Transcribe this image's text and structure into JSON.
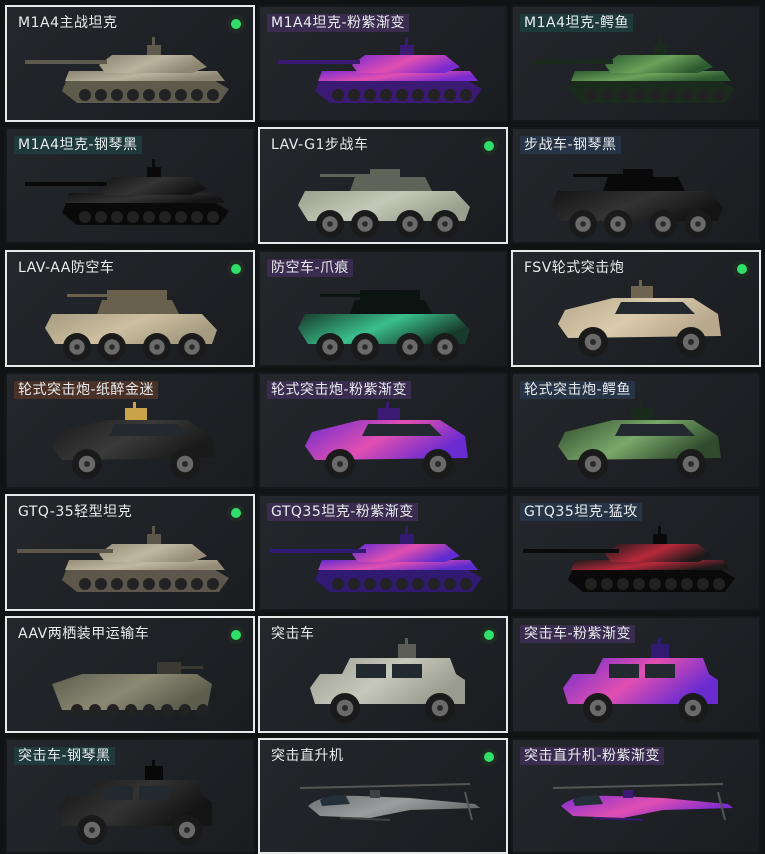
{
  "vehicles": [
    {
      "name": "M1A4主战坦克",
      "selected": true,
      "owned": true,
      "tag": "none",
      "kind": "tank",
      "palette": [
        "#8a8470",
        "#b9b49e",
        "#5f5b4c"
      ]
    },
    {
      "name": "M1A4坦克-粉紫渐变",
      "selected": false,
      "owned": false,
      "tag": "purple",
      "kind": "tank",
      "palette": [
        "#7a2bd0",
        "#e14fb1",
        "#3a1a72"
      ]
    },
    {
      "name": "M1A4坦克-鳄鱼",
      "selected": false,
      "owned": false,
      "tag": "teal",
      "kind": "tank",
      "palette": [
        "#2c5a30",
        "#6aa25a",
        "#1a2a1c"
      ]
    },
    {
      "name": "M1A4坦克-钢琴黑",
      "selected": false,
      "owned": false,
      "tag": "teal",
      "kind": "tank",
      "palette": [
        "#141414",
        "#343434",
        "#0a0a0a"
      ]
    },
    {
      "name": "LAV-G1步战车",
      "selected": true,
      "owned": true,
      "tag": "none",
      "kind": "apc",
      "palette": [
        "#9aa08d",
        "#c4c8b8",
        "#5e6458"
      ]
    },
    {
      "name": "步战车-钢琴黑",
      "selected": false,
      "owned": false,
      "tag": "slate",
      "kind": "apc",
      "palette": [
        "#141414",
        "#333333",
        "#090909"
      ]
    },
    {
      "name": "LAV-AA防空车",
      "selected": true,
      "owned": true,
      "tag": "none",
      "kind": "aa",
      "palette": [
        "#a59a80",
        "#cdbfa0",
        "#6a604e"
      ]
    },
    {
      "name": "防空车-爪痕",
      "selected": false,
      "owned": false,
      "tag": "purple",
      "kind": "aa",
      "palette": [
        "#183a2c",
        "#3ac08c",
        "#0b1410"
      ]
    },
    {
      "name": "FSV轮式突击炮",
      "selected": true,
      "owned": true,
      "tag": "none",
      "kind": "suv",
      "palette": [
        "#b8a88c",
        "#dacbad",
        "#6f6450"
      ]
    },
    {
      "name": "轮式突击炮-纸醉金迷",
      "selected": false,
      "owned": false,
      "tag": "brown",
      "kind": "suv",
      "palette": [
        "#1a1a1a",
        "#3a3a3a",
        "#c9a24a"
      ]
    },
    {
      "name": "轮式突击炮-粉紫渐变",
      "selected": false,
      "owned": false,
      "tag": "purple",
      "kind": "suv",
      "palette": [
        "#6a2bd0",
        "#e14fb1",
        "#3a1a72"
      ]
    },
    {
      "name": "轮式突击炮-鳄鱼",
      "selected": false,
      "owned": false,
      "tag": "slate",
      "kind": "suv",
      "palette": [
        "#2f4a2c",
        "#7aa86a",
        "#1a2a1c"
      ]
    },
    {
      "name": "GTQ-35轻型坦克",
      "selected": true,
      "owned": true,
      "tag": "none",
      "kind": "light",
      "palette": [
        "#958c78",
        "#c0b89f",
        "#5c574a"
      ]
    },
    {
      "name": "GTQ35坦克-粉紫渐变",
      "selected": false,
      "owned": false,
      "tag": "purple",
      "kind": "light",
      "palette": [
        "#5d2bd0",
        "#e14fb1",
        "#301a72"
      ]
    },
    {
      "name": "GTQ35坦克-猛攻",
      "selected": false,
      "owned": false,
      "tag": "slate",
      "kind": "light",
      "palette": [
        "#1a1a1a",
        "#b8293a",
        "#0a0a0a"
      ]
    },
    {
      "name": "AAV两栖装甲运输车",
      "selected": true,
      "owned": true,
      "tag": "none",
      "kind": "aav",
      "palette": [
        "#5d5d4e",
        "#8a8a74",
        "#3a3a30"
      ]
    },
    {
      "name": "突击车",
      "selected": true,
      "owned": true,
      "tag": "none",
      "kind": "truck",
      "palette": [
        "#9a9c90",
        "#c6c8bc",
        "#5c5e55"
      ]
    },
    {
      "name": "突击车-粉紫渐变",
      "selected": false,
      "owned": false,
      "tag": "purple",
      "kind": "truck",
      "palette": [
        "#6a2bd0",
        "#e14fb1",
        "#301a72"
      ]
    },
    {
      "name": "突击车-钢琴黑",
      "selected": false,
      "owned": false,
      "tag": "teal",
      "kind": "truck",
      "palette": [
        "#141414",
        "#333333",
        "#080808"
      ]
    },
    {
      "name": "突击直升机",
      "selected": true,
      "owned": true,
      "tag": "none",
      "kind": "heli",
      "palette": [
        "#6a6e6e",
        "#9a9e9e",
        "#3e4242"
      ]
    },
    {
      "name": "突击直升机-粉紫渐变",
      "selected": false,
      "owned": false,
      "tag": "purple",
      "kind": "heli",
      "palette": [
        "#7a2bd0",
        "#e14fb1",
        "#3a1a72"
      ]
    }
  ]
}
